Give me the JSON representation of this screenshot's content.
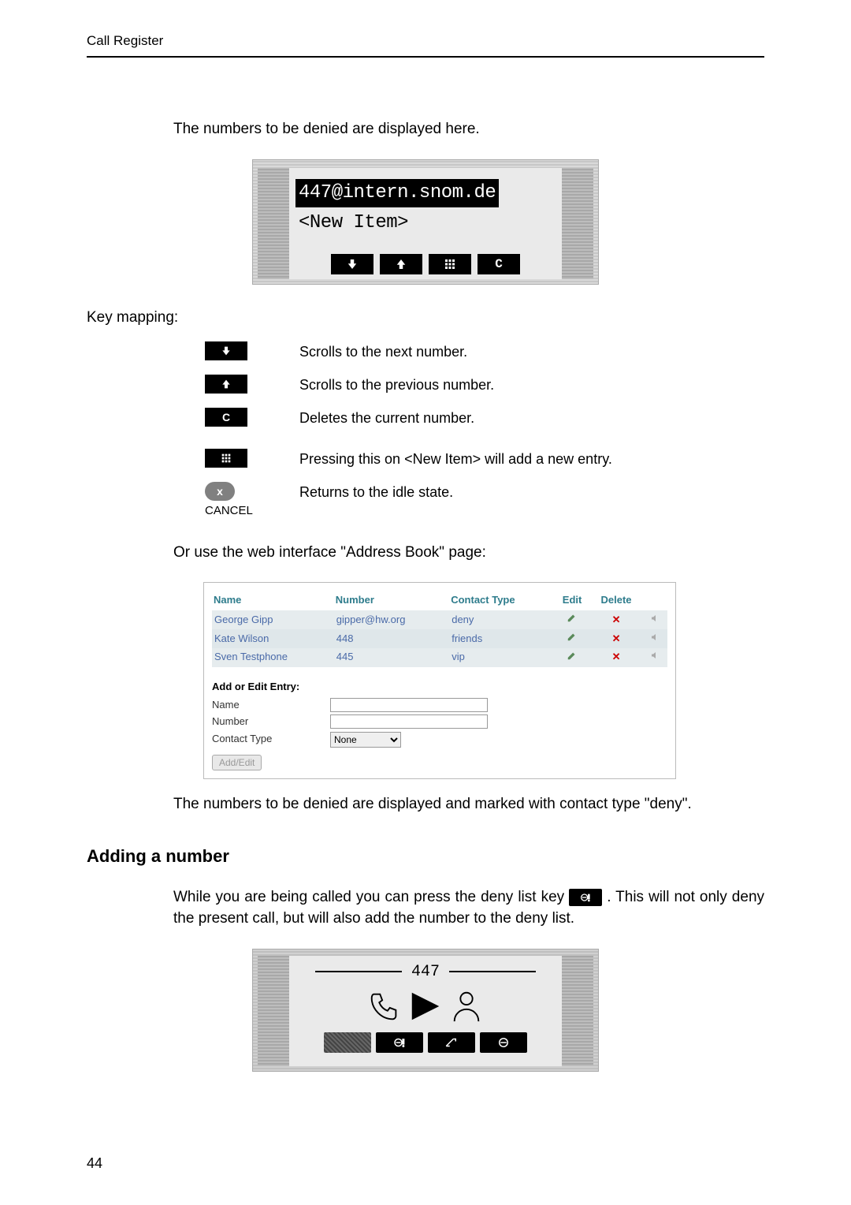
{
  "header_title": "Call Register",
  "page_number": "44",
  "para1": "The numbers to be denied are displayed here.",
  "lcd_highlight": "447@intern.snom.de",
  "lcd_newitem": "<New Item>",
  "keymap_heading": "Key mapping:",
  "km_down": "Scrolls to the next number.",
  "km_up": "Scrolls to the previous number.",
  "km_c": "Deletes the current number.",
  "km_grid": "Pressing this on <New Item> will add a new entry.",
  "km_cancel": "Returns to the idle state.",
  "km_cancel_label": "CANCEL",
  "key_c_glyph": "C",
  "key_x_glyph": "x",
  "para2": "Or use the web interface \"Address Book\" page:",
  "abook": {
    "cols": {
      "name": "Name",
      "number": "Number",
      "ctype": "Contact Type",
      "edit": "Edit",
      "del": "Delete"
    },
    "rows": [
      {
        "name": "George Gipp",
        "number": "gipper@hw.org",
        "ctype": "deny"
      },
      {
        "name": "Kate Wilson",
        "number": "448",
        "ctype": "friends"
      },
      {
        "name": "Sven Testphone",
        "number": "445",
        "ctype": "vip"
      }
    ],
    "form_title": "Add or Edit Entry:",
    "f_name": "Name",
    "f_number": "Number",
    "f_ctype": "Contact Type",
    "f_ctype_value": "None",
    "btn": "Add/Edit"
  },
  "para3": "The numbers to be denied are displayed and marked with contact type \"deny\".",
  "section2_title": "Adding a number",
  "section2_body_a": "While you are being called you can press the deny list key ",
  "section2_body_b": ".  This will not only deny the present call, but will also add the number to the deny list.",
  "call_number": "447"
}
